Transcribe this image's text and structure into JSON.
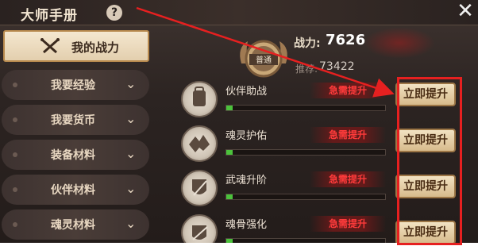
{
  "window": {
    "title": "大师手册",
    "help_glyph": "?",
    "close_glyph": "✕"
  },
  "sidebar": {
    "active": {
      "label": "我的战力",
      "icon": "crossed-swords-icon"
    },
    "items": [
      {
        "label": "我要经验"
      },
      {
        "label": "我要货币"
      },
      {
        "label": "装备材料"
      },
      {
        "label": "伙伴材料"
      },
      {
        "label": "魂灵材料"
      }
    ],
    "chevron_glyph": "⌄"
  },
  "header": {
    "rank_text": "普通",
    "power_label": "战力:",
    "power_value": "7626",
    "recommend_label": "推荐:",
    "recommend_value": "73422"
  },
  "rows": [
    {
      "name": "伙伴助战",
      "status": "急需提升",
      "progress": 0.04,
      "icon": "backpack-icon"
    },
    {
      "name": "魂灵护佑",
      "status": "急需提升",
      "progress": 0.04,
      "icon": "spirit-beast-icon"
    },
    {
      "name": "武魂升阶",
      "status": "急需提升",
      "progress": 0.04,
      "icon": "shield-sword-icon"
    },
    {
      "name": "魂骨强化",
      "status": "急需提升",
      "progress": 0.04,
      "icon": "bone-armor-icon"
    }
  ],
  "boost_button_label": "立即提升",
  "colors": {
    "urgent": "#ff3b3b",
    "progress": "#4cc23c",
    "annotation": "#e62020"
  }
}
